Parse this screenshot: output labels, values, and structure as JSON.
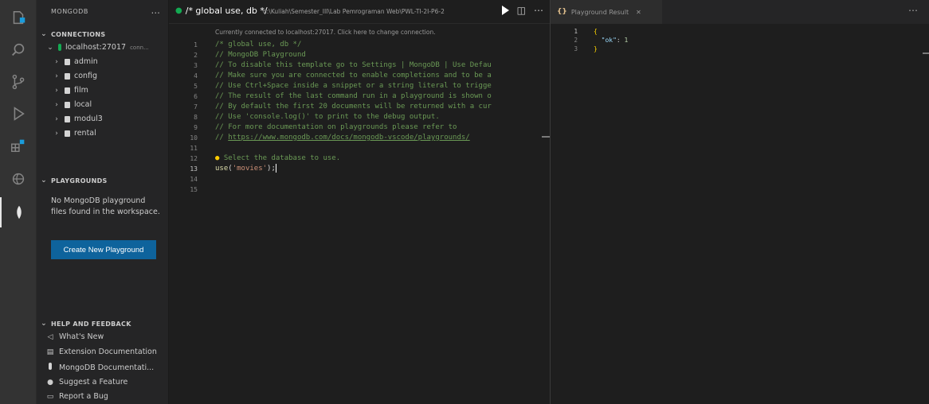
{
  "sidebar": {
    "title": "MONGODB",
    "more": "...",
    "connections": {
      "header": "CONNECTIONS",
      "host": "localhost:27017",
      "host_suffix": "conn...",
      "databases": [
        "admin",
        "config",
        "film",
        "local",
        "modul3",
        "rental"
      ]
    },
    "playgrounds": {
      "header": "PLAYGROUNDS",
      "message": "No MongoDB playground files found in the workspace.",
      "create_button": "Create New Playground"
    },
    "help": {
      "header": "HELP AND FEEDBACK",
      "items": [
        "What's New",
        "Extension Documentation",
        "MongoDB Documentati...",
        "Suggest a Feature",
        "Report a Bug"
      ]
    }
  },
  "editor": {
    "tab_title": "/* global use, db */",
    "tab_path": "d:\\Kuliah\\Semester_III\\Lab Pemrograman Web\\PWL-TI-2I-P6-2",
    "codelens": "Currently connected to localhost:27017. Click here to change connection.",
    "line_numbers": [
      "1",
      "2",
      "3",
      "4",
      "5",
      "6",
      "7",
      "8",
      "9",
      "10",
      "11",
      "12",
      "13",
      "14",
      "15"
    ],
    "lines": {
      "l1": "/* global use, db */",
      "l2": "// MongoDB Playground",
      "l3": "// To disable this template go to Settings | MongoDB | Use Defau",
      "l4": "// Make sure you are connected to enable completions and to be a",
      "l5": "// Use Ctrl+Space inside a snippet or a string literal to trigge",
      "l6": "// The result of the last command run in a playground is shown o",
      "l7": "// By default the first 20 documents will be returned with a cur",
      "l8": "// Use 'console.log()' to print to the debug output.",
      "l9": "// For more documentation on playgrounds please refer to",
      "l10_prefix": "// ",
      "l10_link": "https://www.mongodb.com/docs/mongodb-vscode/playgrounds/",
      "l12": " Select the database to use.",
      "l13_fn": "use",
      "l13_open": "(",
      "l13_str": "'movies'",
      "l13_close": ");"
    }
  },
  "result": {
    "tab_title": "Playground Result",
    "line_numbers": [
      "1",
      "2",
      "3"
    ],
    "open_brace": "{",
    "key": "\"ok\"",
    "colon": ": ",
    "value": "1",
    "close_brace": "}"
  },
  "colors": {
    "accent_green": "#13aa52",
    "button_blue": "#0e639c",
    "comment": "#6a9955",
    "string": "#ce9178"
  },
  "icons": [
    "explorer-icon",
    "search-icon",
    "source-control-icon",
    "run-debug-icon",
    "extensions-icon",
    "remote-explorer-icon",
    "mongodb-leaf-icon"
  ]
}
